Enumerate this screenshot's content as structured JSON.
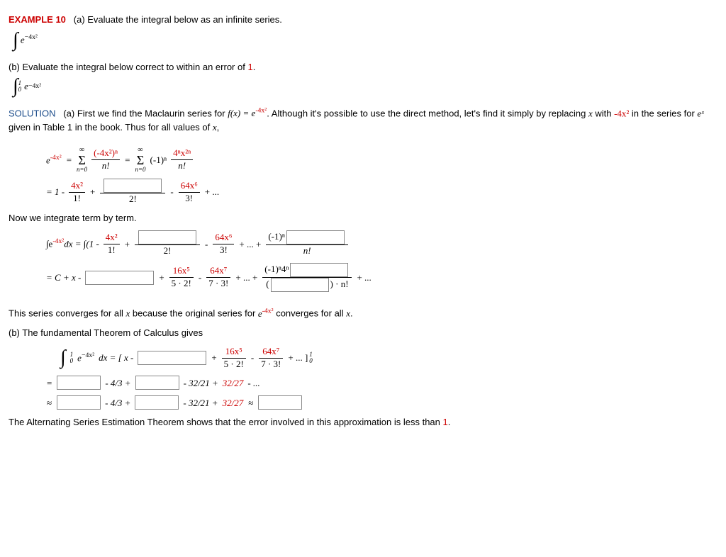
{
  "header": {
    "example_label": "EXAMPLE 10",
    "part_a_prompt": "(a) Evaluate the integral below as an infinite series.",
    "integral_a": "∫ e",
    "integral_a_exp": "−4x²",
    "part_b_prompt_pre": "(b) Evaluate the integral below correct to within an error of ",
    "part_b_prompt_err": "1",
    "part_b_prompt_post": ".",
    "integral_b_upper": "1",
    "integral_b_lower": "0"
  },
  "solution": {
    "label": "SOLUTION",
    "a_text_1": "(a) First we find the Maclaurin series for ",
    "fx": "f(x) = e",
    "fx_exp": "-4x²",
    "a_text_2": ". Although it's possible to use the direct method, let's find it simply by replacing ",
    "var_x": "x",
    "a_text_3": " with ",
    "replace_with": "-4x²",
    "a_text_4": " in the series for ",
    "ex": "eˣ",
    "a_text_5": " given in Table 1 in the book. Thus for all values of ",
    "a_text_6": ","
  },
  "series1": {
    "lhs": "e",
    "lhs_exp": "-4x²",
    "eq": "=",
    "sum_top": "∞",
    "sum_bot": "n=0",
    "frac1_num_red": "(-4x²)ⁿ",
    "frac1_den": "n!",
    "frac2_num_pre": "(-1)ⁿ",
    "frac2_num_red": "4ⁿx²ⁿ",
    "frac2_den": "n!"
  },
  "series2": {
    "eq": "= 1 -",
    "t1_num": "4x²",
    "t1_den": "1!",
    "plus": "+",
    "t2_den": "2!",
    "minus": "-",
    "t3_num": "64x⁶",
    "t3_den": "3!",
    "tail": "+ ..."
  },
  "integrate_label": "Now we integrate term by term.",
  "int1": {
    "lhs": "∫e",
    "lhs_exp": "-4x²",
    "lhs_dx": "dx = ∫(1 -",
    "t1_num": "4x²",
    "t1_den": "1!",
    "plus": "+",
    "t2_den": "2!",
    "minus": "-",
    "t3_num": "64x⁶",
    "t3_den": "3!",
    "dots": "+ ... +",
    "tn_num_pre": "(-1)ⁿ",
    "tn_den": "n!"
  },
  "int2": {
    "lhs": "= C + x -",
    "plus": "+",
    "t2_num": "16x⁵",
    "t2_den": "5 · 2!",
    "minus": "-",
    "t3_num": "64x⁷",
    "t3_den": "7 · 3!",
    "dots": "+ ... +",
    "tn_num_pre": "(-1)ⁿ4ⁿ",
    "tn_den_pre": "(",
    "tn_den_post": ") · n!",
    "tail": "+ ..."
  },
  "converge": {
    "text_1": "This series converges for all ",
    "var_x": "x",
    "text_2": " because the original series for ",
    "ex": "e",
    "ex_exp": "-4x²",
    "text_3": " converges for all ",
    "text_4": "."
  },
  "partb": {
    "header": "(b) The fundamental Theorem of Calculus gives",
    "lhs_int": "∫",
    "upper": "1",
    "lower": "0",
    "integrand": "e",
    "integrand_exp": "−4x²",
    "dx": "dx = [ x -",
    "plus": "+",
    "t2_num": "16x⁵",
    "t2_den": "5 · 2!",
    "minus": "-",
    "t3_num": "64x⁷",
    "t3_den": "7 · 3!",
    "tail": "+ ... ]",
    "bracket_upper": "1",
    "bracket_lower": "0"
  },
  "eval1": {
    "eq": "=",
    "m43": "- 4/3 +",
    "m3221": "- 32/21 +",
    "m3227": "32/27",
    "tail": "- ..."
  },
  "eval2": {
    "approx": "≈",
    "m43": "- 4/3 +",
    "m3221": "- 32/21 +",
    "m3227": "32/27",
    "approx2": "≈"
  },
  "footer": {
    "text_1": "The Alternating Series Estimation Theorem shows that the error involved in this approximation is less than ",
    "err": "1",
    "text_2": "."
  }
}
